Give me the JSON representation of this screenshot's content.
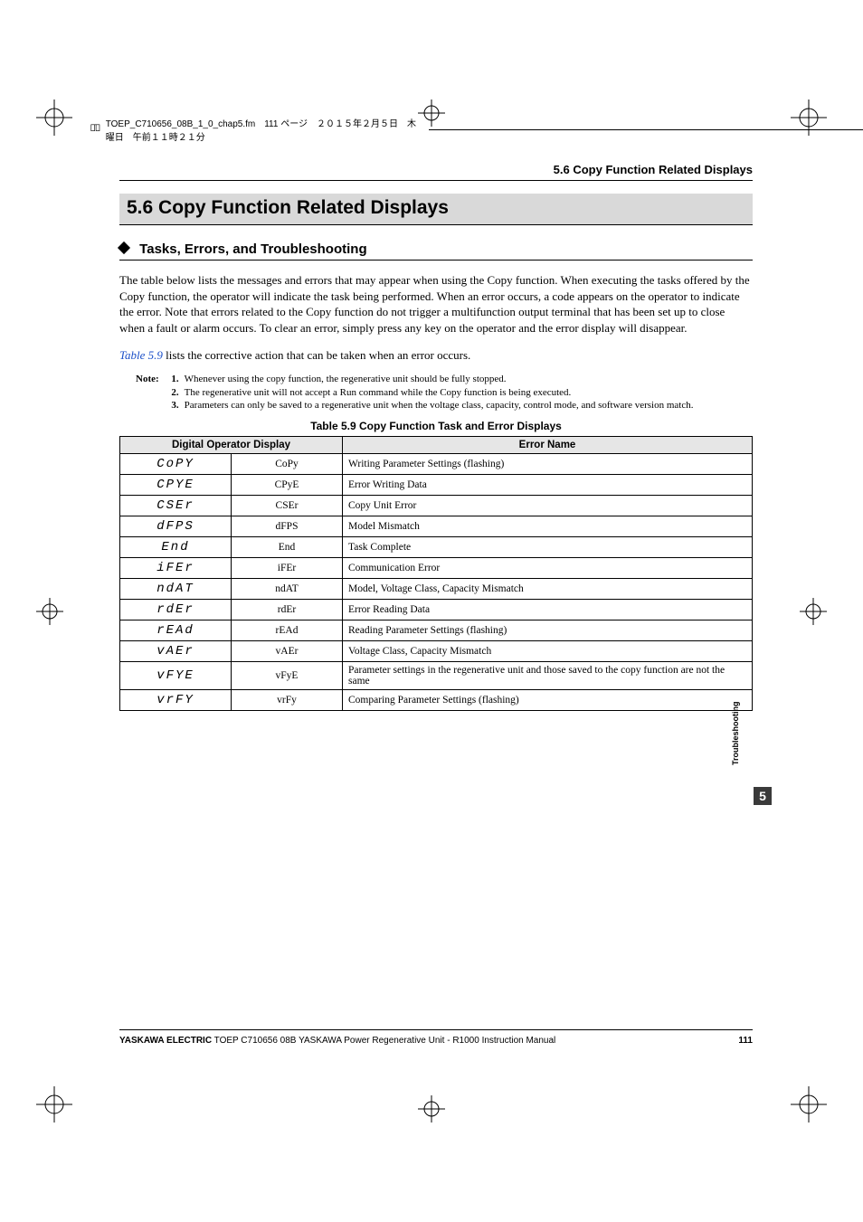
{
  "header_line": "TOEP_C710656_08B_1_0_chap5.fm　111 ページ　２０１５年２月５日　木曜日　午前１１時２１分",
  "running_head": "5.6  Copy Function Related Displays",
  "section_title": "5.6    Copy Function Related Displays",
  "subhead": "Tasks, Errors, and Troubleshooting",
  "body_p1": "The table below lists the messages and errors that may appear when using the Copy function. When executing the tasks offered by the Copy function, the operator will indicate the task being performed. When an error occurs, a code appears on the operator to indicate the error. Note that errors related to the Copy function do not trigger a multifunction output terminal that has been set up to close when a fault or alarm occurs. To clear an error, simply press any key on the operator and the error display will disappear.",
  "body_p2_pre": "Table 5.9",
  "body_p2_post": " lists the corrective action that can be taken when an error occurs.",
  "note_label": "Note:",
  "notes": [
    "Whenever using the copy function, the regenerative unit should be fully stopped.",
    "The regenerative unit will not accept a Run command while the Copy function is being executed.",
    "Parameters can only be saved to a regenerative unit when the voltage class, capacity, control mode, and software version match."
  ],
  "table_caption": "Table 5.9  Copy Function Task and Error Displays",
  "th_display": "Digital Operator Display",
  "th_error": "Error Name",
  "rows": [
    {
      "seg": "CoPY",
      "code": "CoPy",
      "err": "Writing Parameter Settings (flashing)"
    },
    {
      "seg": "CPYE",
      "code": "CPyE",
      "err": "Error Writing Data"
    },
    {
      "seg": "CSEr",
      "code": "CSEr",
      "err": "Copy Unit Error"
    },
    {
      "seg": "dFPS",
      "code": "dFPS",
      "err": "Model Mismatch"
    },
    {
      "seg": "End",
      "code": "End",
      "err": "Task Complete"
    },
    {
      "seg": "iFEr",
      "code": "iFEr",
      "err": "Communication Error"
    },
    {
      "seg": "ndAT",
      "code": "ndAT",
      "err": "Model, Voltage Class, Capacity Mismatch"
    },
    {
      "seg": "rdEr",
      "code": "rdEr",
      "err": "Error Reading Data"
    },
    {
      "seg": "rEAd",
      "code": "rEAd",
      "err": "Reading Parameter Settings (flashing)"
    },
    {
      "seg": "vAEr",
      "code": "vAEr",
      "err": "Voltage Class, Capacity Mismatch"
    },
    {
      "seg": "vFYE",
      "code": "vFyE",
      "err": "Parameter settings in the regenerative unit and those saved to the copy function are not the same"
    },
    {
      "seg": "vrFY",
      "code": "vrFy",
      "err": "Comparing Parameter Settings (flashing)"
    }
  ],
  "side_tab_label": "Troubleshooting",
  "side_tab_num": "5",
  "footer_left_bold": "YASKAWA ELECTRIC",
  "footer_left_rest": " TOEP C710656 08B YASKAWA Power Regenerative Unit - R1000 Instruction Manual",
  "footer_page": "111"
}
